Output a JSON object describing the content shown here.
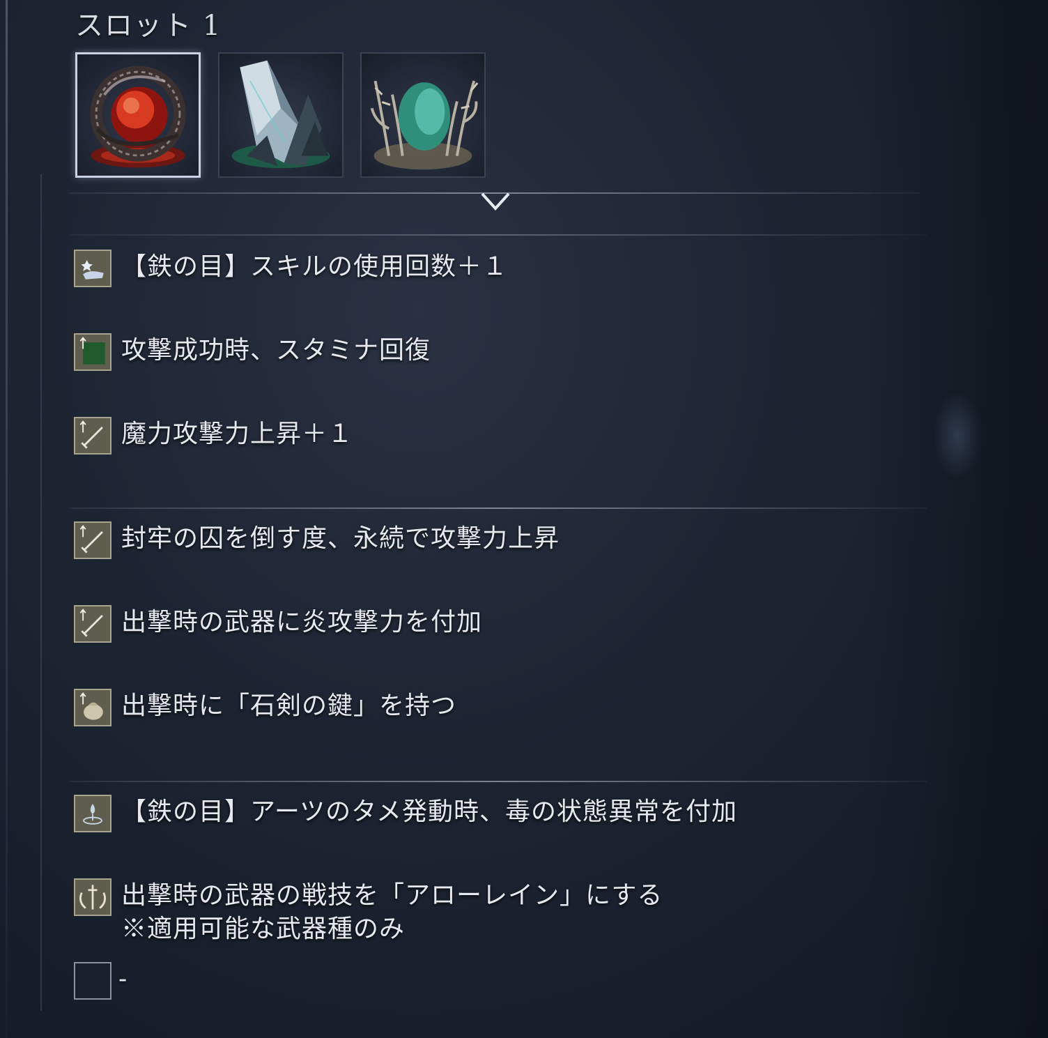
{
  "slot": {
    "title": "スロット 1"
  },
  "relics": [
    {
      "name": "red-orb-relic",
      "selected": true
    },
    {
      "name": "crystal-relic",
      "selected": false
    },
    {
      "name": "green-egg-relic",
      "selected": false
    }
  ],
  "groups": [
    {
      "effects": [
        {
          "icon": "skill-hand-icon",
          "text": "【鉄の目】スキルの使用回数＋１"
        },
        {
          "icon": "stamina-up-icon",
          "text": "攻撃成功時、スタミナ回復"
        },
        {
          "icon": "sword-up-icon",
          "text": "魔力攻撃力上昇＋１"
        }
      ]
    },
    {
      "effects": [
        {
          "icon": "sword-up-icon",
          "text": "封牢の囚を倒す度、永続で攻撃力上昇"
        },
        {
          "icon": "sword-up-icon",
          "text": "出撃時の武器に炎攻撃力を付加"
        },
        {
          "icon": "pouch-icon",
          "text": "出撃時に「石剣の鍵」を持つ"
        }
      ]
    },
    {
      "effects": [
        {
          "icon": "arts-charge-icon",
          "text": "【鉄の目】アーツのタメ発動時、毒の状態異常を付加"
        },
        {
          "icon": "weapon-skill-icon",
          "text": "出撃時の武器の戦技を「アローレイン」にする",
          "note": "※適用可能な武器種のみ"
        },
        {
          "icon": "empty-slot-icon",
          "text": "-"
        }
      ]
    }
  ]
}
